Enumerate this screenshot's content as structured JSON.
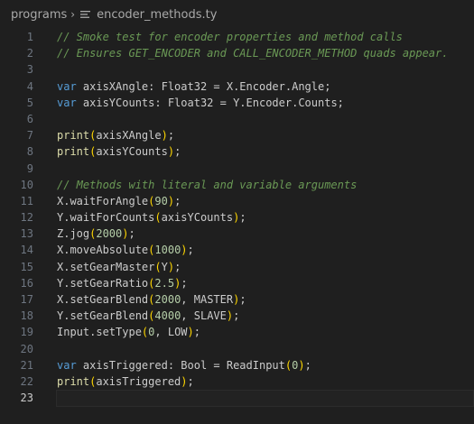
{
  "breadcrumb": {
    "folder": "programs",
    "separator": "›",
    "file": "encoder_methods.ty",
    "file_icon": "lines-file-icon"
  },
  "editor": {
    "current_line": 23,
    "lines": [
      {
        "n": "1",
        "tokens": [
          [
            "comment",
            "// Smoke test for encoder properties and method calls"
          ]
        ]
      },
      {
        "n": "2",
        "tokens": [
          [
            "comment",
            "// Ensures GET_ENCODER and CALL_ENCODER_METHOD quads appear."
          ]
        ]
      },
      {
        "n": "3",
        "tokens": []
      },
      {
        "n": "4",
        "tokens": [
          [
            "kw",
            "var"
          ],
          [
            "punc",
            " axisXAngle: Float32 = X.Encoder.Angle;"
          ]
        ]
      },
      {
        "n": "5",
        "tokens": [
          [
            "kw",
            "var"
          ],
          [
            "punc",
            " axisYCounts: Float32 = Y.Encoder.Counts;"
          ]
        ]
      },
      {
        "n": "6",
        "tokens": []
      },
      {
        "n": "7",
        "tokens": [
          [
            "fn",
            "print"
          ],
          [
            "paren",
            "("
          ],
          [
            "punc",
            "axisXAngle"
          ],
          [
            "paren",
            ")"
          ],
          [
            "punc",
            ";"
          ]
        ]
      },
      {
        "n": "8",
        "tokens": [
          [
            "fn",
            "print"
          ],
          [
            "paren",
            "("
          ],
          [
            "punc",
            "axisYCounts"
          ],
          [
            "paren",
            ")"
          ],
          [
            "punc",
            ";"
          ]
        ]
      },
      {
        "n": "9",
        "tokens": []
      },
      {
        "n": "10",
        "tokens": [
          [
            "comment",
            "// Methods with literal and variable arguments"
          ]
        ]
      },
      {
        "n": "11",
        "tokens": [
          [
            "punc",
            "X.waitForAngle"
          ],
          [
            "paren",
            "("
          ],
          [
            "num",
            "90"
          ],
          [
            "paren",
            ")"
          ],
          [
            "punc",
            ";"
          ]
        ]
      },
      {
        "n": "12",
        "tokens": [
          [
            "punc",
            "Y.waitForCounts"
          ],
          [
            "paren",
            "("
          ],
          [
            "punc",
            "axisYCounts"
          ],
          [
            "paren",
            ")"
          ],
          [
            "punc",
            ";"
          ]
        ]
      },
      {
        "n": "13",
        "tokens": [
          [
            "punc",
            "Z.jog"
          ],
          [
            "paren",
            "("
          ],
          [
            "num",
            "2000"
          ],
          [
            "paren",
            ")"
          ],
          [
            "punc",
            ";"
          ]
        ]
      },
      {
        "n": "14",
        "tokens": [
          [
            "punc",
            "X.moveAbsolute"
          ],
          [
            "paren",
            "("
          ],
          [
            "num",
            "1000"
          ],
          [
            "paren",
            ")"
          ],
          [
            "punc",
            ";"
          ]
        ]
      },
      {
        "n": "15",
        "tokens": [
          [
            "punc",
            "X.setGearMaster"
          ],
          [
            "paren",
            "("
          ],
          [
            "punc",
            "Y"
          ],
          [
            "paren",
            ")"
          ],
          [
            "punc",
            ";"
          ]
        ]
      },
      {
        "n": "16",
        "tokens": [
          [
            "punc",
            "Y.setGearRatio"
          ],
          [
            "paren",
            "("
          ],
          [
            "num",
            "2.5"
          ],
          [
            "paren",
            ")"
          ],
          [
            "punc",
            ";"
          ]
        ]
      },
      {
        "n": "17",
        "tokens": [
          [
            "punc",
            "X.setGearBlend"
          ],
          [
            "paren",
            "("
          ],
          [
            "num",
            "2000"
          ],
          [
            "punc",
            ", MASTER"
          ],
          [
            "paren",
            ")"
          ],
          [
            "punc",
            ";"
          ]
        ]
      },
      {
        "n": "18",
        "tokens": [
          [
            "punc",
            "Y.setGearBlend"
          ],
          [
            "paren",
            "("
          ],
          [
            "num",
            "4000"
          ],
          [
            "punc",
            ", SLAVE"
          ],
          [
            "paren",
            ")"
          ],
          [
            "punc",
            ";"
          ]
        ]
      },
      {
        "n": "19",
        "tokens": [
          [
            "punc",
            "Input.setType"
          ],
          [
            "paren",
            "("
          ],
          [
            "num",
            "0"
          ],
          [
            "punc",
            ", LOW"
          ],
          [
            "paren",
            ")"
          ],
          [
            "punc",
            ";"
          ]
        ]
      },
      {
        "n": "20",
        "tokens": []
      },
      {
        "n": "21",
        "tokens": [
          [
            "kw",
            "var"
          ],
          [
            "punc",
            " axisTriggered: Bool = ReadInput"
          ],
          [
            "paren",
            "("
          ],
          [
            "num",
            "0"
          ],
          [
            "paren",
            ")"
          ],
          [
            "punc",
            ";"
          ]
        ]
      },
      {
        "n": "22",
        "tokens": [
          [
            "fn",
            "print"
          ],
          [
            "paren",
            "("
          ],
          [
            "punc",
            "axisTriggered"
          ],
          [
            "paren",
            ")"
          ],
          [
            "punc",
            ";"
          ]
        ]
      },
      {
        "n": "23",
        "tokens": []
      }
    ]
  },
  "colors": {
    "background": "#1f1f1f",
    "comment": "#6a9955",
    "keyword": "#569cd6",
    "number": "#b5cea8",
    "bracket": "#ffd700"
  }
}
